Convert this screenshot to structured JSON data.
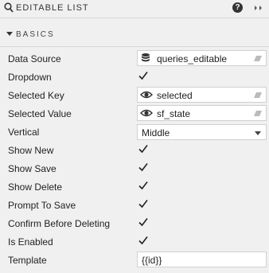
{
  "header": {
    "title": "EDITABLE LIST",
    "help_glyph": "?"
  },
  "section": {
    "label": "BASICS"
  },
  "properties": {
    "data_source": {
      "label": "Data Source",
      "value": "queries_editable"
    },
    "dropdown": {
      "label": "Dropdown",
      "checked": true
    },
    "selected_key": {
      "label": "Selected Key",
      "value": "selected"
    },
    "selected_value": {
      "label": "Selected Value",
      "value": "sf_state"
    },
    "vertical": {
      "label": "Vertical",
      "value": "Middle"
    },
    "show_new": {
      "label": "Show New",
      "checked": true
    },
    "show_save": {
      "label": "Show Save",
      "checked": true
    },
    "show_delete": {
      "label": "Show Delete",
      "checked": true
    },
    "prompt_to_save": {
      "label": "Prompt To Save",
      "checked": true
    },
    "confirm_before_deleting": {
      "label": "Confirm Before Deleting",
      "checked": true
    },
    "is_enabled": {
      "label": "Is Enabled",
      "checked": true
    },
    "template": {
      "label": "Template",
      "value": "{{id}}"
    }
  },
  "icons": {
    "search": "search-icon",
    "help": "help-icon",
    "collapse": "double-chevron-right-icon",
    "database": "database-icon",
    "eye": "eye-icon",
    "eraser": "eraser-icon",
    "check": "checkmark-icon"
  }
}
